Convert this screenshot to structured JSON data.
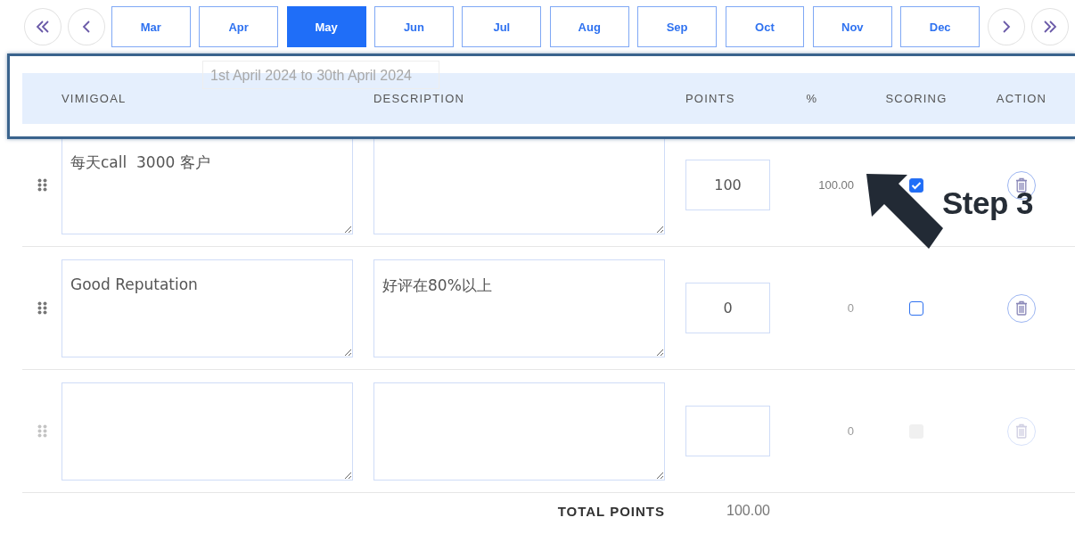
{
  "nav": {
    "months": [
      {
        "label": "Mar",
        "selected": false
      },
      {
        "label": "Apr",
        "selected": false
      },
      {
        "label": "May",
        "selected": true
      },
      {
        "label": "Jun",
        "selected": false
      },
      {
        "label": "Jul",
        "selected": false
      },
      {
        "label": "Aug",
        "selected": false
      },
      {
        "label": "Sep",
        "selected": false
      },
      {
        "label": "Oct",
        "selected": false
      },
      {
        "label": "Nov",
        "selected": false
      },
      {
        "label": "Dec",
        "selected": false
      }
    ]
  },
  "period_hint": "1st April 2024 to 30th April 2024",
  "table": {
    "columns": [
      "VIMIGOAL",
      "DESCRIPTION",
      "POINTS",
      "%",
      "SCORING",
      "ACTION"
    ],
    "rows": [
      {
        "goal": "每天call  3000 客户",
        "points": "100",
        "percent": "100.00",
        "scoring": true,
        "disabled": false
      },
      {
        "goal": "Good Reputation",
        "description": "好评在80%以上",
        "points": "0",
        "percent": "0",
        "scoring": false,
        "disabled": false
      },
      {
        "percent": "0",
        "scoring": false,
        "disabled": true
      }
    ]
  },
  "total": {
    "label": "TOTAL POINTS",
    "value": "100.00"
  },
  "annotation": {
    "text": "Step 3"
  }
}
